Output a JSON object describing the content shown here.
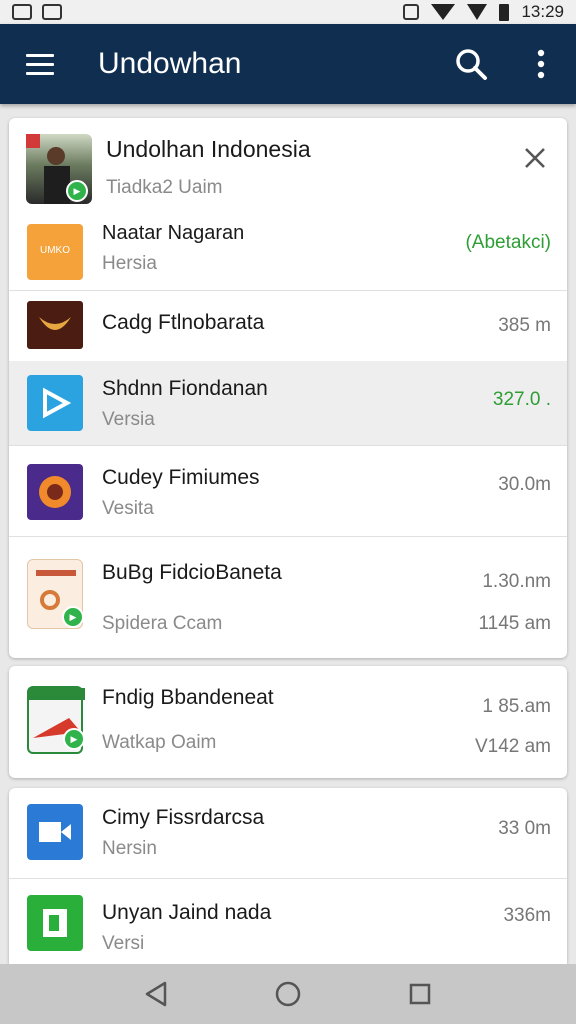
{
  "status_bar": {
    "time": "13:29"
  },
  "app_bar": {
    "title": "Undowhan"
  },
  "header_card": {
    "title": "Undolhan Indonesia",
    "subtitle": "Tiadka2 Uaim"
  },
  "items": [
    {
      "title": "Naatar Nagaran",
      "subtitle": "Hersia",
      "meta": "(Abetakci)",
      "meta_color": "#2e9e35"
    },
    {
      "title": "Cadg Ftlnobarata",
      "meta": "385 m"
    },
    {
      "title": "Shdnn Fiondanan",
      "subtitle": "Versia",
      "meta": "327.0 .",
      "meta_color": "#2e9e35"
    },
    {
      "title": "Cudey Fimiumes",
      "subtitle": "Vesita",
      "meta": "30.0m"
    },
    {
      "title": "BuBg FidcioBaneta",
      "subtitle": "Spidera Ccam",
      "meta": "1.30.nm",
      "meta2": "1145 am"
    }
  ],
  "card2_item": {
    "title": "Fndig Bbandeneat",
    "subtitle": "Watkap Oaim",
    "meta": "1 85.am",
    "meta2": "V142 am"
  },
  "card3_items": [
    {
      "title": "Cimy Fissrdarcsa",
      "subtitle": "Nersin",
      "meta": "33 0m"
    },
    {
      "title": "Unyan Jaind nada",
      "subtitle": "Versi",
      "meta": "336m"
    }
  ],
  "icons": {
    "menu": "hamburger-menu-icon",
    "search": "search-icon",
    "more": "more-vert-icon",
    "close": "close-icon",
    "back": "back-triangle-icon",
    "home": "home-circle-icon",
    "recents": "recents-square-icon"
  },
  "colors": {
    "app_bar": "#102e50",
    "accent_green": "#2e9e35"
  }
}
